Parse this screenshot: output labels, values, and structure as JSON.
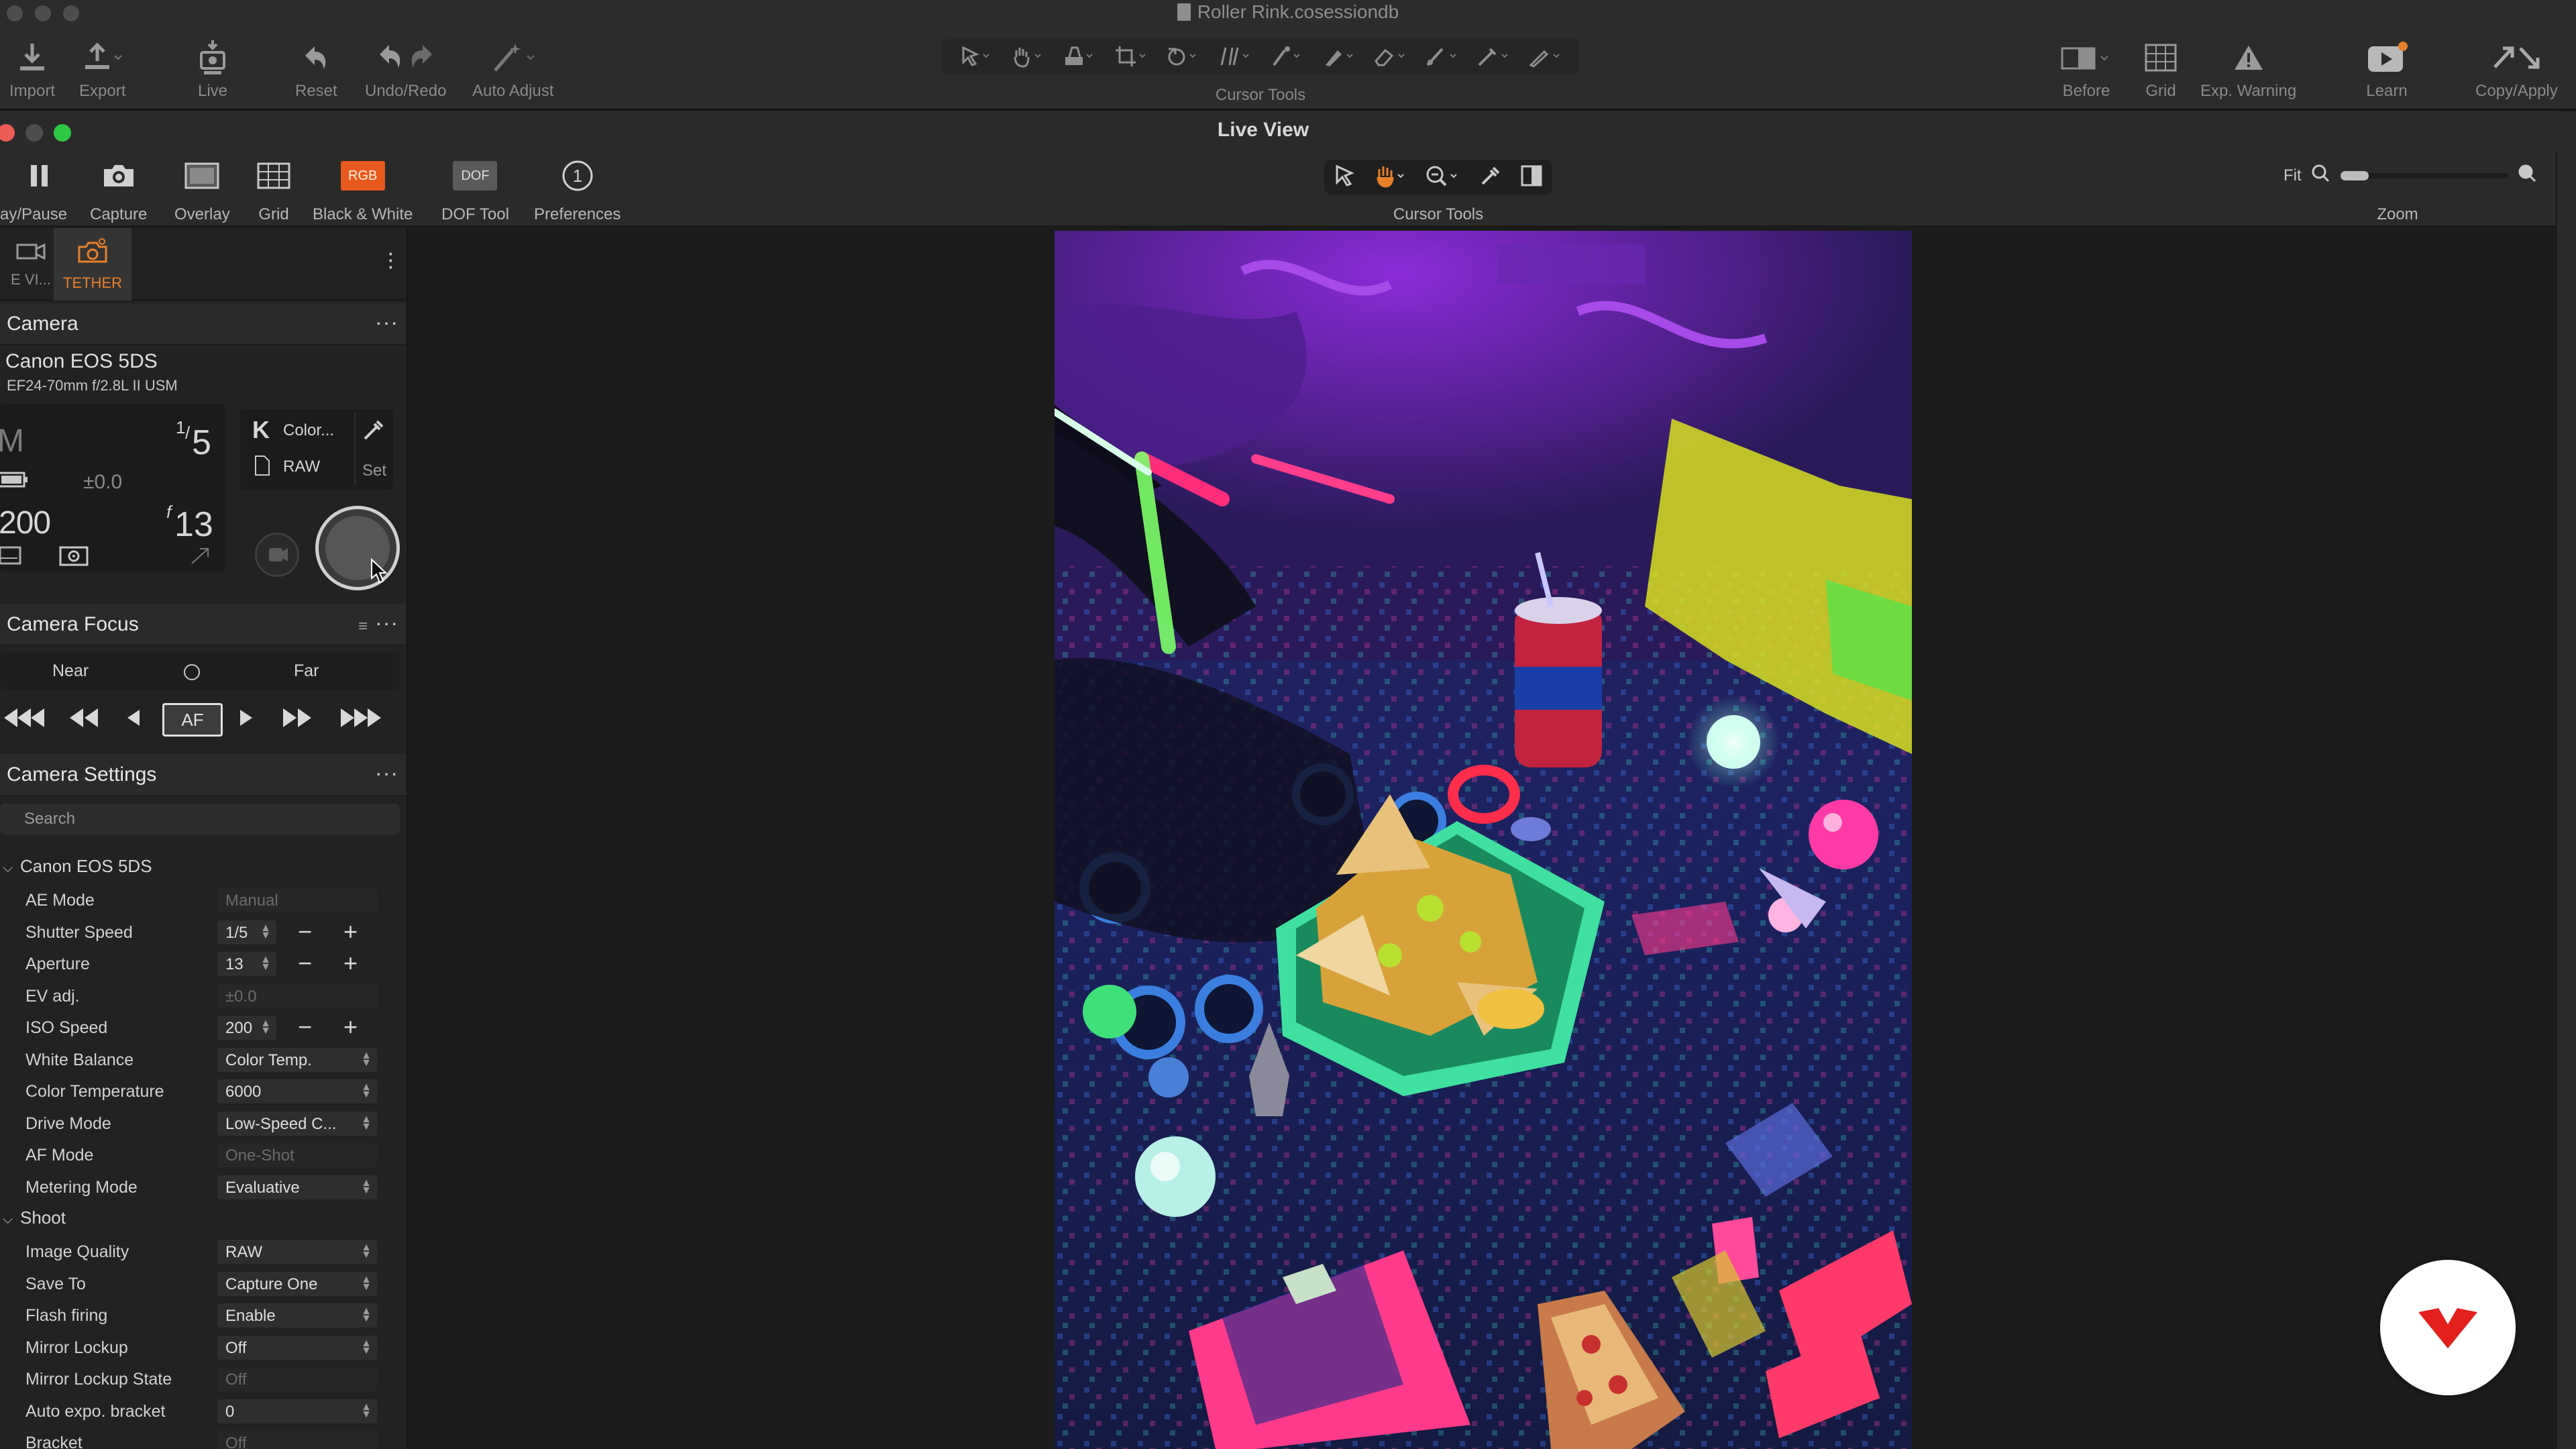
{
  "window": {
    "document_title": "Roller Rink.cosessiondb"
  },
  "main_toolbar": {
    "import": "Import",
    "export": "Export",
    "live": "Live",
    "reset": "Reset",
    "undo_redo": "Undo/Redo",
    "auto_adjust": "Auto Adjust",
    "cursor_tools": "Cursor Tools",
    "before": "Before",
    "grid": "Grid",
    "exp_warning": "Exp. Warning",
    "learn": "Learn",
    "copy_apply": "Copy/Apply"
  },
  "live_view": {
    "title": "Live View",
    "toolbar": {
      "play_pause": "ay/Pause",
      "capture": "Capture",
      "overlay": "Overlay",
      "grid": "Grid",
      "black_white": "Black & White",
      "black_white_badge": "RGB",
      "dof_tool": "DOF Tool",
      "dof_badge": "DOF",
      "preferences": "Preferences",
      "cursor_tools": "Cursor Tools",
      "zoom_fit": "Fit",
      "zoom": "Zoom"
    }
  },
  "panel": {
    "tabs": [
      {
        "label": "E VI..."
      },
      {
        "label": "TETHER"
      }
    ],
    "camera": {
      "title": "Camera",
      "model": "Canon EOS 5DS",
      "lens": "EF24-70mm f/2.8L II USM",
      "mode": "M",
      "shutter_num": "1",
      "shutter_den": "5",
      "ev": "±0.0",
      "iso": "200",
      "aperture_prefix": "f",
      "aperture": "13",
      "wb_letter": "K",
      "wb_label": "Color...",
      "format": "RAW",
      "set_label": "Set"
    },
    "focus": {
      "title": "Camera Focus",
      "near": "Near",
      "far": "Far",
      "af": "AF"
    },
    "settings": {
      "title": "Camera Settings",
      "search_placeholder": "Search",
      "group1": "Canon EOS 5DS",
      "group2": "Shoot",
      "rows": [
        {
          "label": "AE Mode",
          "value": "Manual"
        },
        {
          "label": "Shutter Speed",
          "value": "1/5"
        },
        {
          "label": "Aperture",
          "value": "13"
        },
        {
          "label": "EV adj.",
          "value": "±0.0"
        },
        {
          "label": "ISO Speed",
          "value": "200"
        },
        {
          "label": "White Balance",
          "value": "Color Temp."
        },
        {
          "label": "Color Temperature",
          "value": "6000"
        },
        {
          "label": "Drive Mode",
          "value": "Low-Speed C..."
        },
        {
          "label": "AF Mode",
          "value": "One-Shot"
        },
        {
          "label": "Metering Mode",
          "value": "Evaluative"
        }
      ],
      "shoot_rows": [
        {
          "label": "Image Quality",
          "value": "RAW"
        },
        {
          "label": "Save To",
          "value": "Capture One"
        },
        {
          "label": "Flash firing",
          "value": "Enable"
        },
        {
          "label": "Mirror Lockup",
          "value": "Off"
        },
        {
          "label": "Mirror Lockup State",
          "value": "Off"
        },
        {
          "label": "Auto expo. bracket",
          "value": "0"
        },
        {
          "label": "Bracket",
          "value": "Off"
        }
      ]
    }
  },
  "colors": {
    "accent_orange": "#e8802a",
    "rgb_badge": "#e8591d",
    "traffic_red": "#ed5b56",
    "traffic_yellow": "#4d4d4d",
    "traffic_green": "#2fc842",
    "logo_red": "#e3201b"
  }
}
